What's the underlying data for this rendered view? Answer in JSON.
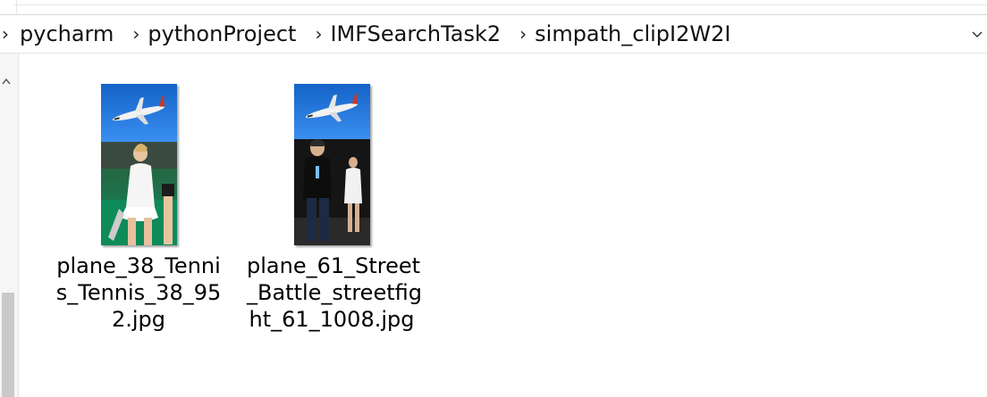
{
  "breadcrumb": {
    "items": [
      "pycharm",
      "pythonProject",
      "IMFSearchTask2",
      "simpath_clipI2W2I"
    ],
    "separator_icon": "chevron-right-icon",
    "dropdown_icon": "chevron-down-icon"
  },
  "navpane": {
    "scroll_icon": "chevron-up-icon"
  },
  "files": [
    {
      "name": "plane_38_Tenni\ns_Tennis_38_95\n2.jpg",
      "thumbnail": "airplane-over-tennis-player-image"
    },
    {
      "name": "plane_61_Street\n_Battle_streetfig\nht_61_1008.jpg",
      "thumbnail": "airplane-over-street-people-image"
    }
  ],
  "colors": {
    "sky": "#1a6fd6",
    "court_green": "#1f7a4f",
    "street_dark": "#1b1b1b"
  }
}
